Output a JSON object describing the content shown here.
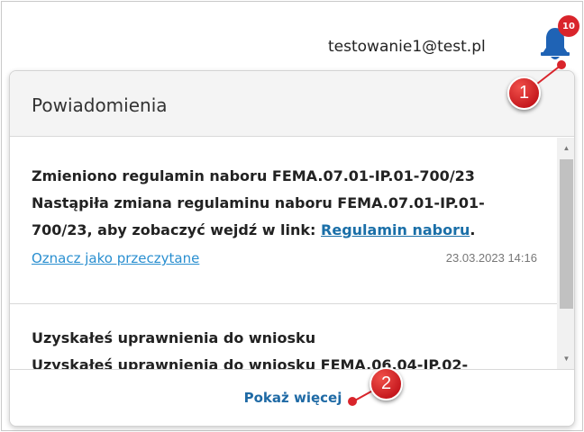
{
  "header": {
    "user_email": "testowanie1@test.pl",
    "bell_icon": "bell-icon",
    "notification_count": "10"
  },
  "panel": {
    "title": "Powiadomienia",
    "notifications": [
      {
        "title": "Zmieniono regulamin naboru FEMA.07.01-IP.01-700/23",
        "body": "Nastąpiła zmiana regulaminu naboru FEMA.07.01-IP.01-700/23, aby zobaczyć wejdź w link:",
        "link_label": "Regulamin naboru",
        "trailing": ".",
        "mark_read_label": "Oznacz jako przeczytane",
        "date": "23.03.2023 14:16"
      },
      {
        "title": "Uzyskałeś uprawnienia do wniosku",
        "body": "Uzyskałeś uprawnienia do wniosku FEMA.06.04-IP.02-"
      }
    ],
    "show_more_label": "Pokaż więcej"
  },
  "callouts": [
    "1",
    "2"
  ],
  "colors": {
    "bell": "#1f63b5",
    "badge": "#d9242b",
    "link": "#1a6fa8",
    "mark_read": "#2a8fd0",
    "show_more": "#1f6aa5",
    "callout": "#c4161c"
  }
}
